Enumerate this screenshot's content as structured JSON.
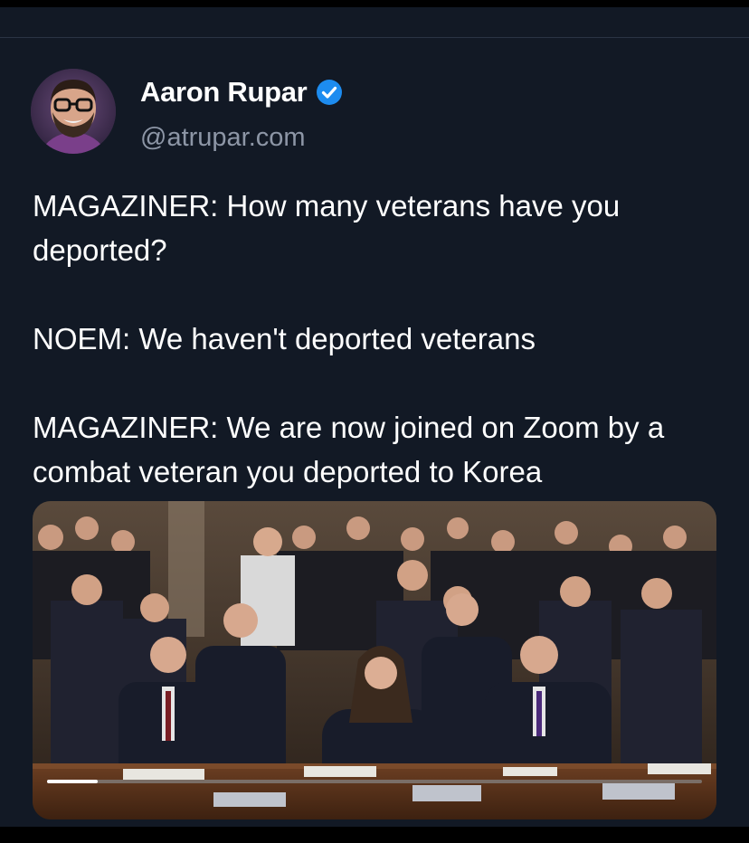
{
  "author": {
    "display_name": "Aaron Rupar",
    "handle": "@atrupar.com",
    "verified": true,
    "avatar_icon": "avatar-photo"
  },
  "post": {
    "text": "MAGAZINER: How many veterans have you deported?\n\nNOEM: We haven't deported veterans\n\nMAGAZINER: We are now joined on Zoom by a combat veteran you deported to Korea"
  },
  "media": {
    "kind": "video-still",
    "description_icon": "hearing-room-photo"
  },
  "colors": {
    "background": "#121925",
    "text": "#ffffff",
    "secondary_text": "#8d96a6",
    "verified_badge": "#1d8cf0"
  }
}
